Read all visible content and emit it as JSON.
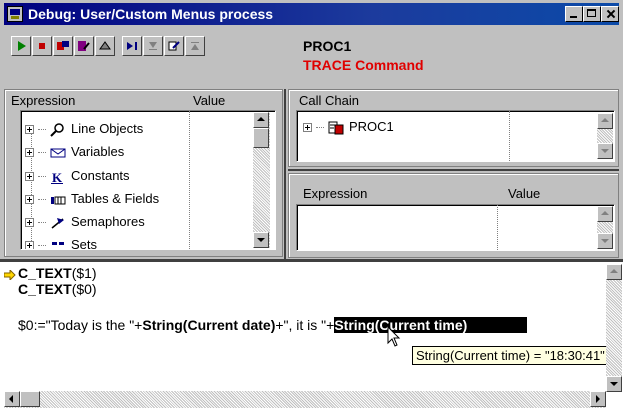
{
  "window": {
    "title": "Debug: User/Custom Menus process"
  },
  "header": {
    "process": "PROC1",
    "trace": "TRACE Command",
    "trace_color": "#e00000"
  },
  "toolbar": {
    "buttons": [
      {
        "name": "run-icon"
      },
      {
        "name": "abort-icon"
      },
      {
        "name": "trace-icon"
      },
      {
        "name": "step-into-icon"
      },
      {
        "name": "step-over-icon"
      },
      {
        "name": "step-out-icon"
      },
      {
        "name": "goto-cursor-icon"
      },
      {
        "name": "editor-icon"
      },
      {
        "name": "up-level-icon"
      }
    ]
  },
  "expression_pane": {
    "col_expression": "Expression",
    "col_value": "Value",
    "items": [
      {
        "label": "Line Objects",
        "icon": "magnifier-icon"
      },
      {
        "label": "Variables",
        "icon": "variables-icon"
      },
      {
        "label": "Constants",
        "icon": "constants-icon"
      },
      {
        "label": "Tables & Fields",
        "icon": "tables-icon"
      },
      {
        "label": "Semaphores",
        "icon": "semaphore-icon"
      },
      {
        "label": "Sets",
        "icon": "sets-icon"
      }
    ]
  },
  "call_chain": {
    "header": "Call Chain",
    "items": [
      {
        "label": "PROC1",
        "icon": "procedure-icon"
      }
    ]
  },
  "custom_watch": {
    "col_expression": "Expression",
    "col_value": "Value"
  },
  "source": {
    "line1_func": "C_TEXT",
    "line1_arg": "($1)",
    "line2_func": "C_TEXT",
    "line2_arg": "($0)",
    "line3_a": "$0:=\"Today is the \"+",
    "line3_b": "String(Current date)",
    "line3_c": "+\", it is \"+",
    "line3_sel": "String(Current time)"
  },
  "tooltip": "String(Current time) = \"18:30:41\""
}
